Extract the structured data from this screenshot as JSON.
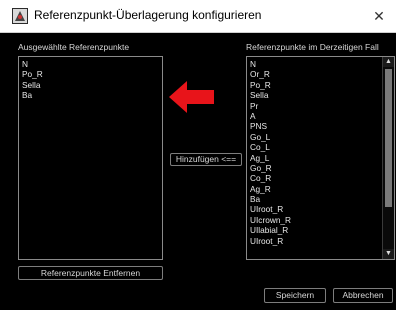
{
  "window": {
    "title": "Referenzpunkt-Überlagerung konfigurieren",
    "close_glyph": "✕"
  },
  "left_panel": {
    "label": "Ausgewählte Referenzpunkte",
    "items": [
      "N",
      "Po_R",
      "Sella",
      "Ba"
    ],
    "remove_button": "Referenzpunkte Entfernen"
  },
  "right_panel": {
    "label": "Referenzpunkte im Derzeitigen Fall",
    "items": [
      "N",
      "Or_R",
      "Po_R",
      "Sella",
      "Pr",
      "A",
      "PNS",
      "Go_L",
      "Co_L",
      "Ag_L",
      "Go_R",
      "Co_R",
      "Ag_R",
      "Ba",
      "UIroot_R",
      "UIcrown_R",
      "UIlabial_R",
      "UIroot_R"
    ]
  },
  "add_button": "Hinzufügen <==",
  "footer": {
    "save": "Speichern",
    "cancel": "Abbrechen"
  },
  "colors": {
    "arrow": "#e8141a",
    "background": "#000000",
    "border": "#8a8a8a"
  },
  "icons": {
    "app": "app-logo-icon",
    "arrow": "red-left-arrow-icon",
    "scroll_up": "scroll-up-icon",
    "scroll_down": "scroll-down-icon"
  }
}
